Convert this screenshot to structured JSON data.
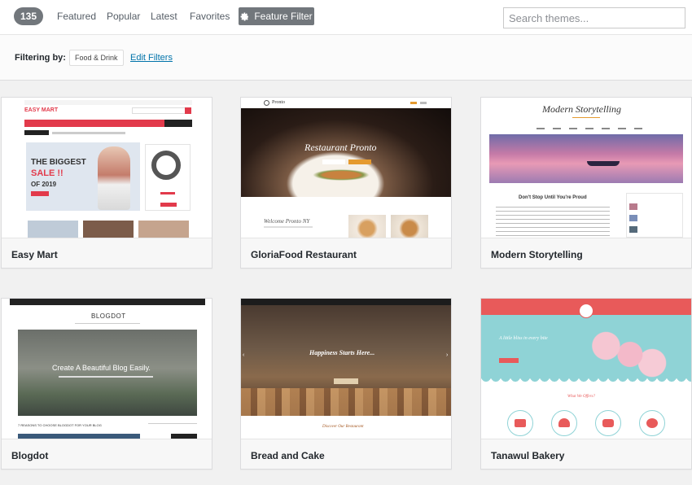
{
  "topbar": {
    "count": "135",
    "nav": [
      "Featured",
      "Popular",
      "Latest",
      "Favorites"
    ],
    "feature_filter": "Feature Filter",
    "search_placeholder": "Search themes..."
  },
  "filter": {
    "label": "Filtering by:",
    "tag": "Food & Drink",
    "edit": "Edit Filters"
  },
  "themes": [
    {
      "name": "Easy Mart",
      "preview": {
        "logo": "EASY MART",
        "promo_line1": "THE BIGGEST",
        "promo_line2": "SALE !!",
        "promo_line3": "OF 2019"
      }
    },
    {
      "name": "GloriaFood Restaurant",
      "preview": {
        "logo": "Pronto",
        "hero": "Restaurant Pronto",
        "section": "Welcome Pronto NY"
      }
    },
    {
      "name": "Modern Storytelling",
      "preview": {
        "title": "Modern Storytelling",
        "post": "Don't Stop Until You're Proud"
      }
    },
    {
      "name": "Blogdot",
      "preview": {
        "logo": "BLOGDOT",
        "hero": "Create A Beautiful Blog Easily.",
        "sub": "7 REASONS TO CHOOSE BLOGDOT FOR YOUR BLOG"
      }
    },
    {
      "name": "Bread and Cake",
      "preview": {
        "hero": "Happiness Starts Here...",
        "section": "Discover Our Restaurant"
      }
    },
    {
      "name": "Tanawul Bakery",
      "preview": {
        "hero": "A little bliss in every bite",
        "section": "What We Offers?"
      }
    }
  ]
}
